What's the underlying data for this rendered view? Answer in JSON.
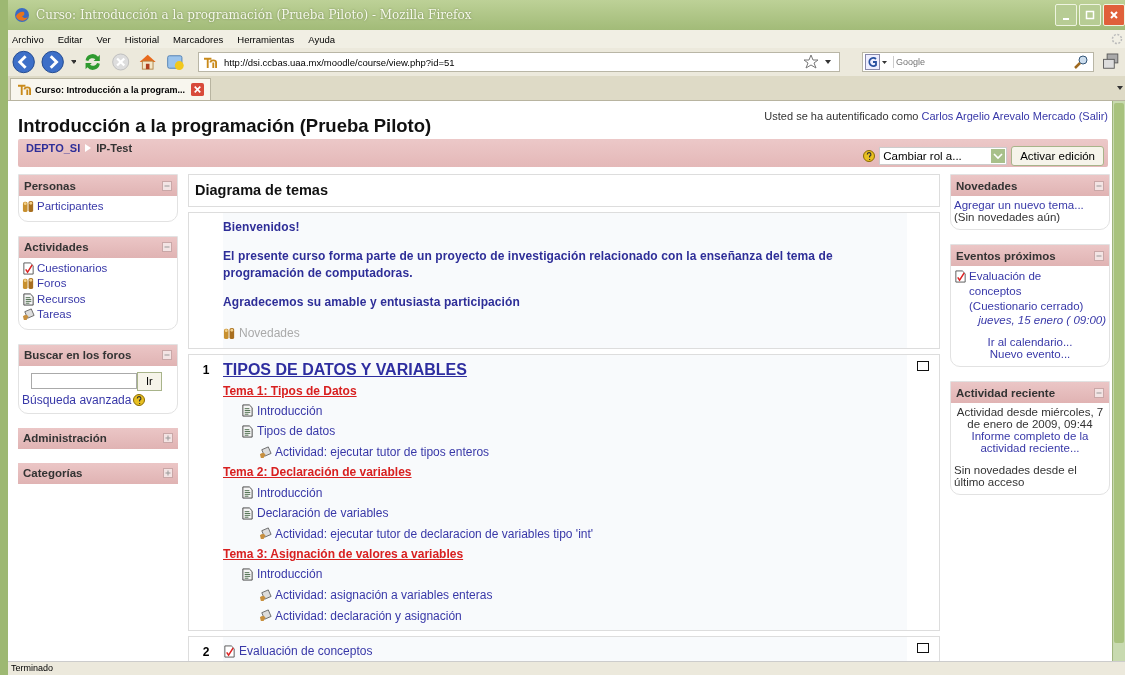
{
  "window": {
    "title": "Curso: Introducción a la programación (Prueba Piloto) - Mozilla Firefox"
  },
  "menu": [
    "Archivo",
    "Editar",
    "Ver",
    "Historial",
    "Marcadores",
    "Herramientas",
    "Ayuda"
  ],
  "address": {
    "url": "http://dsi.ccbas.uaa.mx/moodle/course/view.php?id=51"
  },
  "search": {
    "placeholder": "Google"
  },
  "tabs": [
    {
      "label": "Curso: Introducción a la program...",
      "selected": true
    }
  ],
  "page": {
    "title": "Introducción a la programación (Prueba Piloto)",
    "login": {
      "prefix": "Usted se ha autentificado como",
      "user": "Carlos Argelio Arevalo Mercado",
      "logout": "(Salir)"
    },
    "breadcrumb": [
      "DEPTO_SI",
      "IP-Test"
    ],
    "role_select": "Cambiar rol a...",
    "edit_button": "Activar edición"
  },
  "left_blocks": [
    {
      "kind": "links",
      "title": "Personas",
      "expanded": true,
      "items": [
        {
          "kind": "people",
          "label": "Participantes"
        }
      ]
    },
    {
      "kind": "links",
      "title": "Actividades",
      "expanded": true,
      "items": [
        {
          "kind": "quiz",
          "label": "Cuestionarios"
        },
        {
          "kind": "forum",
          "label": "Foros"
        },
        {
          "kind": "resource",
          "label": "Recursos"
        },
        {
          "kind": "assignment",
          "label": "Tareas"
        }
      ]
    },
    {
      "kind": "search",
      "title": "Buscar en los foros",
      "expanded": true,
      "button": "Ir",
      "advanced": "Búsqueda avanzada"
    },
    {
      "title": "Administración",
      "expanded": false
    },
    {
      "title": "Categorías",
      "expanded": false
    }
  ],
  "content": {
    "heading": "Diagrama de temas",
    "intro": {
      "lines": [
        "Bienvenidos!",
        "El presente curso forma parte de un proyecto de investigación relacionado con la enseñanza del tema de programación de computadoras.",
        "Agradecemos su amable y entusiasta participación"
      ],
      "forum": {
        "label": "Novedades",
        "hidden": true
      }
    },
    "sections": [
      {
        "number": "1",
        "title": "TIPOS DE DATOS Y VARIABLES",
        "topics": [
          {
            "title": "Tema 1: Tipos de Datos",
            "items": [
              {
                "kind": "resource",
                "label": "Introducción"
              },
              {
                "kind": "resource",
                "label": "Tipos de datos",
                "children": [
                  {
                    "kind": "assignment",
                    "label": "Actividad: ejecutar tutor de tipos enteros"
                  }
                ]
              }
            ]
          },
          {
            "title": "Tema 2: Declaración de variables",
            "items": [
              {
                "kind": "resource",
                "label": "Introducción"
              },
              {
                "kind": "resource",
                "label": "Declaración de variables",
                "children": [
                  {
                    "kind": "assignment",
                    "label": "Actividad: ejecutar tutor de declaracion de variables tipo 'int'"
                  }
                ]
              }
            ]
          },
          {
            "title": "Tema 3: Asignación de valores a variables",
            "items": [
              {
                "kind": "resource",
                "label": "Introducción",
                "children": [
                  {
                    "kind": "assignment",
                    "label": "Actividad: asignación a variables enteras"
                  },
                  {
                    "kind": "assignment",
                    "label": "Actividad: declaración y asignación"
                  }
                ]
              }
            ]
          }
        ]
      },
      {
        "number": "2",
        "items": [
          {
            "kind": "quiz",
            "label": "Evaluación de conceptos"
          }
        ]
      }
    ]
  },
  "right_blocks": [
    {
      "kind": "news",
      "title": "Novedades",
      "expanded": true,
      "link": "Agregar un nuevo tema...",
      "note": "(Sin novedades aún)"
    },
    {
      "kind": "events",
      "title": "Eventos próximos",
      "expanded": true,
      "events": [
        {
          "kind": "quiz",
          "label": "Evaluación de conceptos (Cuestionario cerrado)",
          "date": "jueves, 15 enero ( 09:00)"
        }
      ],
      "links": [
        "Ir al calendario...",
        "Nuevo evento..."
      ]
    },
    {
      "kind": "recent",
      "title": "Actividad reciente",
      "expanded": true,
      "since": "Actividad desde miércoles, 7 de enero de 2009, 09:44",
      "link": "Informe completo de la actividad reciente...",
      "note": "Sin novedades desde el último acceso"
    }
  ],
  "status_bar": "Terminado"
}
